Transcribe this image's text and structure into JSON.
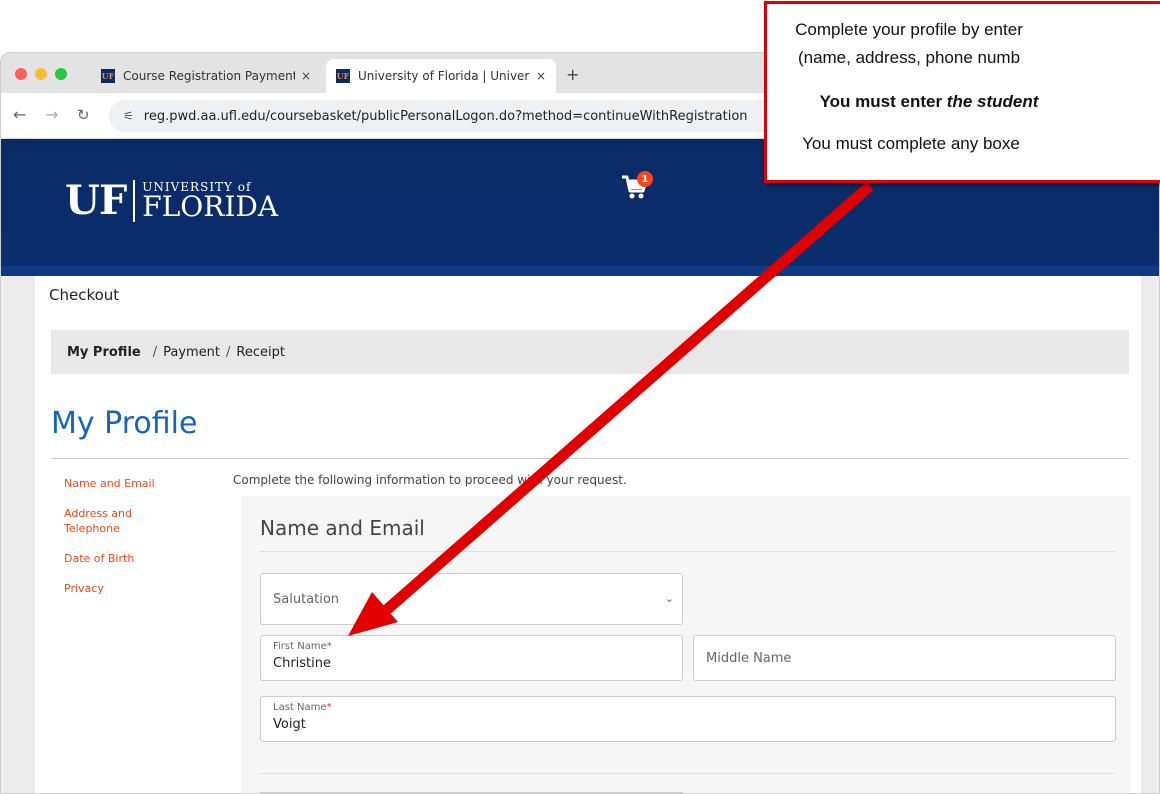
{
  "browser": {
    "tabs": [
      {
        "label": "Course Registration Payment",
        "close": "×"
      },
      {
        "label": "University of Florida | Univers",
        "close": "×"
      }
    ],
    "new_tab": "+",
    "url": "reg.pwd.aa.ufl.edu/coursebasket/publicPersonalLogon.do?method=continueWithRegistration"
  },
  "header": {
    "logo_uf": "UF",
    "logo_university": "UNIVERSITY of",
    "logo_florida": "FLORIDA",
    "cart_count": "1"
  },
  "page": {
    "checkout_label": "Checkout",
    "breadcrumb": {
      "current": "My Profile",
      "sep": "/",
      "payment": "Payment",
      "receipt": "Receipt"
    },
    "title": "My Profile",
    "sidenav": [
      "Name and Email",
      "Address and Telephone",
      "Date of Birth",
      "Privacy"
    ],
    "intro": "Complete the following information to proceed with your request."
  },
  "form": {
    "section_title": "Name and Email",
    "salutation_placeholder": "Salutation",
    "first_name_label": "First Name",
    "first_name_value": "Christine",
    "middle_name_placeholder": "Middle Name",
    "last_name_label": "Last Name",
    "last_name_value": "Voigt",
    "required_mark": "*"
  },
  "callout": {
    "line1": "Complete your profile by enter",
    "line2": "(name, address, phone numb",
    "line3_a": "You must enter ",
    "line3_b": "the student",
    "line4": "You must complete any boxe"
  },
  "colors": {
    "uf_blue": "#0a2a66",
    "uf_orange": "#fa4616",
    "title_blue": "#1565c0",
    "callout_red": "#e00000"
  }
}
